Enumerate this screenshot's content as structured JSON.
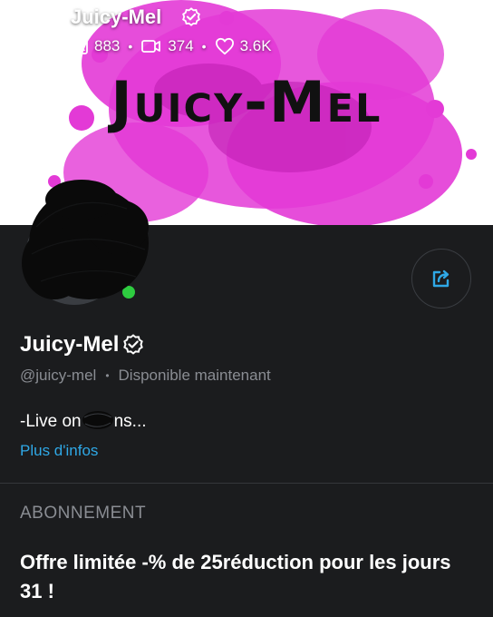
{
  "header": {
    "creator_name": "Juicy-Mel",
    "stats": {
      "photos": "883",
      "videos": "374",
      "likes": "3.6K"
    }
  },
  "cover": {
    "title": "Juicy-Mel"
  },
  "profile": {
    "name": "Juicy-Mel",
    "handle": "@juicy-mel",
    "separator": "•",
    "availability": "Disponible maintenant",
    "bio_start": "-Live on",
    "bio_end": "ns...",
    "more_info": "Plus d'infos"
  },
  "subscription": {
    "label": "ABONNEMENT",
    "offer": "Offre limitée -% de 25réduction pour les jours 31 !"
  },
  "icons": {
    "back": "arrow-left-icon",
    "verified": "verified-badge-icon",
    "photos": "image-icon",
    "videos": "video-icon",
    "likes": "heart-icon",
    "menu": "more-vertical-icon",
    "share": "share-icon"
  },
  "colors": {
    "accent_link": "#2fa8e6",
    "background": "#1b1c1e",
    "online": "#2ecc40",
    "splash": "#e33ad6"
  }
}
